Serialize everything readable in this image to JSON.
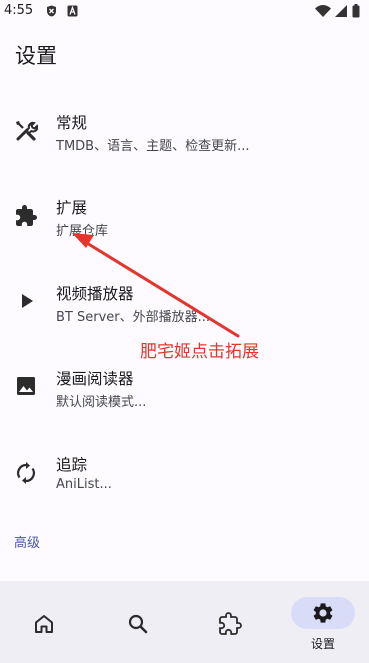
{
  "status": {
    "time": "4:55"
  },
  "page": {
    "title": "设置"
  },
  "items": [
    {
      "label": "常规",
      "sub": "TMDB、语言、主题、检查更新..."
    },
    {
      "label": "扩展",
      "sub": "扩展仓库"
    },
    {
      "label": "视频播放器",
      "sub": "BT Server、外部播放器..."
    },
    {
      "label": "漫画阅读器",
      "sub": "默认阅读模式..."
    },
    {
      "label": "追踪",
      "sub": "AniList..."
    }
  ],
  "section": {
    "advanced": "高级"
  },
  "annotation": {
    "text": "肥宅姬点击拓展",
    "color": "#e2352e"
  },
  "nav": {
    "active_label": "设置",
    "icons": [
      "home-icon",
      "search-icon",
      "puzzle-icon",
      "gear-icon"
    ]
  },
  "colors": {
    "accent": "#4a57a8",
    "nav_bg": "#efeef5",
    "active_pill": "#d9dcf7"
  }
}
